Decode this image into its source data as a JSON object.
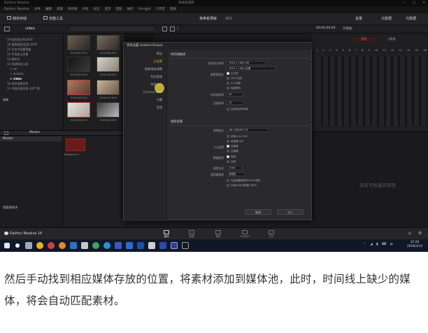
{
  "window": {
    "title": "DaVinci Resolve",
    "center_title": "未命名项目",
    "window_controls": [
      "—",
      "□",
      "✕"
    ]
  },
  "menu": [
    "DaVinci Resolve",
    "文件",
    "编辑",
    "剪辑",
    "时间线",
    "片段",
    "标记",
    "显示",
    "回放",
    "协作",
    "Fairlight",
    "工作区",
    "帮助"
  ],
  "toolbar": {
    "media_storage": "媒体存储",
    "clone_tool": "克隆工具",
    "project_title": "未命名项目",
    "project_subtitle": "编辑",
    "right_items": [
      "音量",
      "元数据",
      "元数据"
    ],
    "timecode": "00:00:00:00"
  },
  "subbar": {
    "bin_label": "video",
    "right_label": "元数据"
  },
  "storage_tree": [
    {
      "label": "19 国庆假日的2019",
      "selected": false
    },
    {
      "label": "16 爱情喜剧/民国 2019",
      "selected": false
    },
    {
      "label": "15 北京夕阳暮霭美",
      "selected": false
    },
    {
      "label": "14 专用有山风景",
      "selected": false
    },
    {
      "label": "13 城风光",
      "selected": false
    },
    {
      "label": "12 西湖荷花公园",
      "selected": false
    },
    {
      "label": "> src",
      "selected": false
    },
    {
      "label": "> mnikha",
      "selected": false
    },
    {
      "label": "> video",
      "selected": true
    },
    {
      "label": "10 南京夜景宣传",
      "selected": false
    },
    {
      "label": "11 中国风景民宿 LOFT 版",
      "selected": false
    }
  ],
  "left_group_label": "录制",
  "media_clips": [
    {
      "label": "MVI05467.MOV"
    },
    {
      "label": "MVI05468.MOV"
    },
    {
      "label": "MVI05469.MOV"
    },
    {
      "label": "MVI05466.MOV"
    },
    {
      "label": "MVI05469.MOV"
    },
    {
      "label": "MVI05470.MOV"
    },
    {
      "label": "MVI05468.MOV"
    },
    {
      "label": "MVI05469.MOV"
    }
  ],
  "master_panel": {
    "header": "Master",
    "item": "Master",
    "footer": "智能媒体夹"
  },
  "sequence": {
    "label": "Sequence 1"
  },
  "dialog": {
    "title": "项目设置:Untitled Project",
    "side_items": [
      {
        "label": "预设",
        "selected": false
      },
      {
        "label": "主设置",
        "selected": true
      },
      {
        "label": "图像缩放调整",
        "selected": false
      },
      {
        "label": "色彩管理",
        "selected": false
      },
      {
        "label": "常规选项",
        "selected": false
      },
      {
        "label": "Camera RAW",
        "selected": false
      },
      {
        "label": "字幕",
        "selected": false
      },
      {
        "label": "音频",
        "selected": false
      }
    ],
    "section1": "时间线格式",
    "rows1": [
      {
        "label": "时间线分辨率",
        "value": "1920 x 1080 HD"
      },
      {
        "label": "",
        "value": "1920 x 1080 处理"
      },
      {
        "label": "像素宽高比",
        "value": "正方形"
      },
      {
        "label": "",
        "value": "16:9 变形"
      },
      {
        "label": "",
        "value": "4:3 标清"
      },
      {
        "label": "",
        "value": "电影镜头"
      },
      {
        "label": "时间线帧率",
        "value": "25"
      },
      {
        "label": "回放帧率",
        "value": "25"
      },
      {
        "label": "",
        "value": "启用丢帧时间码"
      }
    ],
    "section2": "视频监看",
    "rows2": [
      {
        "label": "视频格式",
        "value": "HD 1080PsF 25"
      },
      {
        "label": "",
        "value": "使用4:4:4 SDI"
      },
      {
        "label": "",
        "value": "单链路 SDI"
      },
      {
        "label": "SDI配置",
        "value": "双链路"
      },
      {
        "label": "",
        "value": "四链路"
      },
      {
        "label": "数据级别",
        "value": "视频"
      },
      {
        "label": "",
        "value": "全部"
      },
      {
        "label": "视频位深",
        "value": "10bit"
      },
      {
        "label": "监视器缩放",
        "value": "双线性"
      },
      {
        "label": "",
        "value": "对监视器使用Rec601矩阵"
      },
      {
        "label": "",
        "value": "启用HDR元数据 HDMI"
      }
    ],
    "cancel": "取消",
    "save": "保存"
  },
  "right_panel": {
    "tabs": [
      "音频",
      "元数据"
    ],
    "channels": [
      "1",
      "2",
      "3",
      "4",
      "5",
      "6",
      "7",
      "8",
      "9",
      "10",
      "11",
      "12",
      "13",
      "14",
      "15",
      "16"
    ],
    "empty_text": "没有可检查的项目"
  },
  "pages": [
    {
      "label": "媒体",
      "active": true
    },
    {
      "label": "剪辑",
      "active": false
    },
    {
      "label": "调色",
      "active": false
    },
    {
      "label": "Fairlight",
      "active": false
    },
    {
      "label": "交付",
      "active": false
    }
  ],
  "app_name": "DaVinci Resolve 14",
  "taskbar": {
    "time": "22:26",
    "date": "2018/3/14"
  },
  "caption": "然后手动找到相应媒体存放的位置，将素材添加到媒体池，此时，时间线上缺少的媒体，将会自动匹配素材。",
  "colors": {
    "accent": "#e8a13a",
    "bg": "#1b1b1d",
    "taskbar": "#101828"
  }
}
